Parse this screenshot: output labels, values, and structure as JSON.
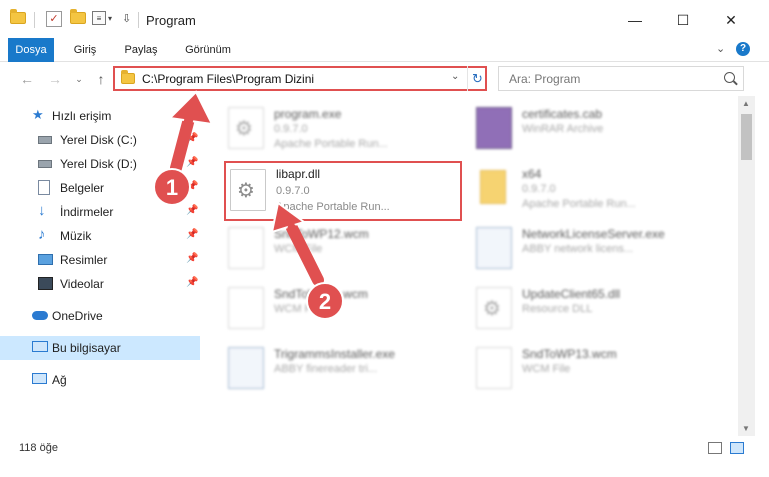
{
  "window": {
    "title": "Program",
    "minimize": "—",
    "maximize": "☐",
    "close": "✕"
  },
  "ribbon": {
    "tabs": [
      {
        "label": "Dosya"
      },
      {
        "label": "Giriş"
      },
      {
        "label": "Paylaş"
      },
      {
        "label": "Görünüm"
      }
    ]
  },
  "nav": {
    "address": "C:\\Program Files\\Program Dizini",
    "search_placeholder": "Ara: Program"
  },
  "sidebar": {
    "items": [
      {
        "label": "Hızlı erişim",
        "icon": "star-icon"
      },
      {
        "label": "Yerel Disk (C:)",
        "icon": "drive-icon"
      },
      {
        "label": "Yerel Disk (D:)",
        "icon": "drive-icon"
      },
      {
        "label": "Belgeler",
        "icon": "documents-icon"
      },
      {
        "label": "İndirmeler",
        "icon": "download-icon"
      },
      {
        "label": "Müzik",
        "icon": "music-icon"
      },
      {
        "label": "Resimler",
        "icon": "pictures-icon"
      },
      {
        "label": "Videolar",
        "icon": "video-icon"
      },
      {
        "label": "OneDrive",
        "icon": "cloud-icon"
      },
      {
        "label": "Bu bilgisayar",
        "icon": "computer-icon"
      },
      {
        "label": "Ağ",
        "icon": "network-icon"
      }
    ]
  },
  "files": [
    {
      "name": "program.exe",
      "line2": "0.9.7.0",
      "line3": "Apache Portable Run..."
    },
    {
      "name": "certificates.cab",
      "line2": "WinRAR Archive",
      "line3": ""
    },
    {
      "name": "libapr.dll",
      "line2": "0.9.7.0",
      "line3": "Apache Portable Run..."
    },
    {
      "name": "x64",
      "line2": "0.9.7.0",
      "line3": "Apache Portable Run..."
    },
    {
      "name": "SndToWP12.wcm",
      "line2": "WCM File",
      "line3": ""
    },
    {
      "name": "NetworkLicenseServer.exe",
      "line2": "ABBY network licens...",
      "line3": ""
    },
    {
      "name": "SndToWP11.wcm",
      "line2": "WCM File",
      "line3": ""
    },
    {
      "name": "UpdateClient65.dll",
      "line2": "Resource DLL",
      "line3": ""
    },
    {
      "name": "TrigrammsInstaller.exe",
      "line2": "ABBY finereader tri...",
      "line3": ""
    },
    {
      "name": "SndToWP13.wcm",
      "line2": "WCM File",
      "line3": ""
    }
  ],
  "status": {
    "count": "118 öğe"
  },
  "annotations": {
    "step1": "1",
    "step2": "2",
    "color": "#e05050"
  }
}
